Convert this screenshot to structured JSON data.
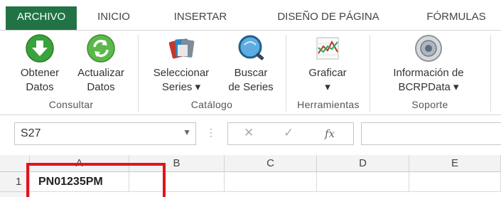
{
  "tabs": [
    "ARCHIVO",
    "INICIO",
    "INSERTAR",
    "DISEÑO DE PÁGINA",
    "FÓRMULAS"
  ],
  "ribbon": {
    "buttons": [
      {
        "line1": "Obtener",
        "line2": "Datos",
        "icon": "green-download-icon"
      },
      {
        "line1": "Actualizar",
        "line2": "Datos",
        "icon": "green-refresh-icon"
      },
      {
        "line1": "Seleccionar",
        "line2": "Series ▾",
        "icon": "series-cards-icon"
      },
      {
        "line1": "Buscar",
        "line2": "de Series",
        "icon": "magnifier-globe-icon"
      },
      {
        "line1": "Graficar",
        "line2": "▾",
        "icon": "line-chart-icon"
      },
      {
        "line1": "Información de",
        "line2": "BCRPData ▾",
        "icon": "info-seal-icon"
      }
    ],
    "groups": [
      "Consultar",
      "Catálogo",
      "Herramientas",
      "Soporte"
    ]
  },
  "formula_bar": {
    "name_box": "S27",
    "dropdown": "▼",
    "dots": "⋮",
    "cancel": "✕",
    "enter": "✓",
    "fx": "fx",
    "value": ""
  },
  "grid": {
    "columns": [
      "A",
      "B",
      "C",
      "D",
      "E"
    ],
    "rows": [
      {
        "num": "1",
        "cells": [
          "PN01235PM",
          "",
          "",
          "",
          ""
        ]
      }
    ]
  },
  "colors": {
    "accent": "#217346",
    "highlight": "#e0141e"
  }
}
